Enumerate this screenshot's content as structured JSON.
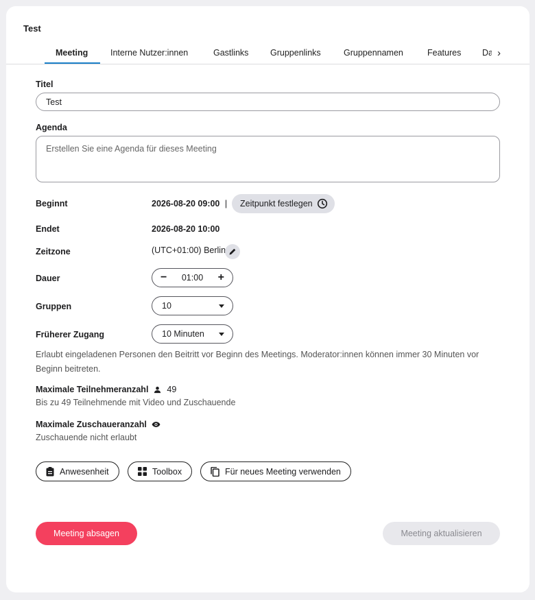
{
  "meeting": {
    "title": "Test"
  },
  "tabs": [
    {
      "label": "Meeting"
    },
    {
      "label": "Interne Nutzer:innen"
    },
    {
      "label": "Gastlinks"
    },
    {
      "label": "Gruppenlinks"
    },
    {
      "label": "Gruppennamen"
    },
    {
      "label": "Features"
    },
    {
      "label": "Da"
    }
  ],
  "form": {
    "titel_label": "Titel",
    "titel_value": "Test",
    "agenda_label": "Agenda",
    "agenda_placeholder": "Erstellen Sie eine Agenda für dieses Meeting",
    "beginnt_label": "Beginnt",
    "beginnt_value": "2026-08-20 09:00",
    "separator": "|",
    "set_time_button": "Zeitpunkt festlegen",
    "endet_label": "Endet",
    "endet_value": "2026-08-20 10:00",
    "zeitzone_label": "Zeitzone",
    "zeitzone_value": "(UTC+01:00) Berlin",
    "dauer_label": "Dauer",
    "dauer_value": "01:00",
    "gruppen_label": "Gruppen",
    "gruppen_value": "10",
    "frueherer_label": "Früherer Zugang",
    "frueherer_value": "10 Minuten",
    "frueherer_help": "Erlaubt eingeladenen Personen den Beitritt vor Beginn des Meetings. Moderator:innen können immer 30 Minuten vor Beginn beitreten.",
    "max_teilnehmer_label": "Maximale Teilnehmeranzahl",
    "max_teilnehmer_value": "49",
    "max_teilnehmer_sub": "Bis zu 49 Teilnehmende mit Video und Zuschauende",
    "max_zuschauer_label": "Maximale Zuschaueranzahl",
    "max_zuschauer_sub": "Zuschauende nicht erlaubt"
  },
  "actions": {
    "anwesenheit": "Anwesenheit",
    "toolbox": "Toolbox",
    "reuse": "Für neues Meeting verwenden",
    "cancel": "Meeting absagen",
    "update": "Meeting aktualisieren"
  },
  "colors": {
    "accent": "#1a7fc7",
    "danger": "#f4405e",
    "pill": "#dfe0e6"
  }
}
